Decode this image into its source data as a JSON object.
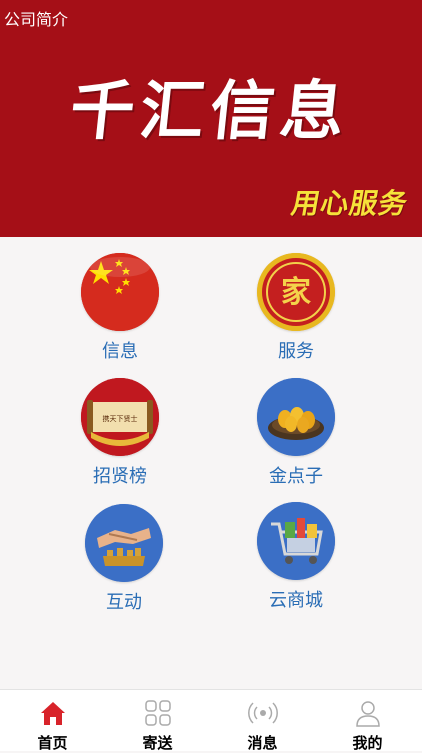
{
  "header": {
    "title": "公司简介",
    "brand": "千汇信息",
    "slogan": "用心服务",
    "background_color": "#a50f17"
  },
  "menu": {
    "items": [
      {
        "label": "信息",
        "icon": "china-flag-icon"
      },
      {
        "label": "服务",
        "icon": "family-emblem-icon"
      },
      {
        "label": "招贤榜",
        "icon": "scroll-icon"
      },
      {
        "label": "金点子",
        "icon": "golden-eggs-icon"
      },
      {
        "label": "互动",
        "icon": "handshake-icon"
      },
      {
        "label": "云商城",
        "icon": "shopping-cart-icon"
      }
    ],
    "scroll_text": "携天下贤士",
    "emblem_char": "家",
    "label_color": "#2a6db5"
  },
  "tabbar": {
    "items": [
      {
        "label": "首页",
        "icon": "home-icon",
        "active": true
      },
      {
        "label": "寄送",
        "icon": "grid-icon",
        "active": false
      },
      {
        "label": "消息",
        "icon": "broadcast-icon",
        "active": false
      },
      {
        "label": "我的",
        "icon": "user-icon",
        "active": false
      }
    ],
    "active_color": "#d8232a"
  }
}
